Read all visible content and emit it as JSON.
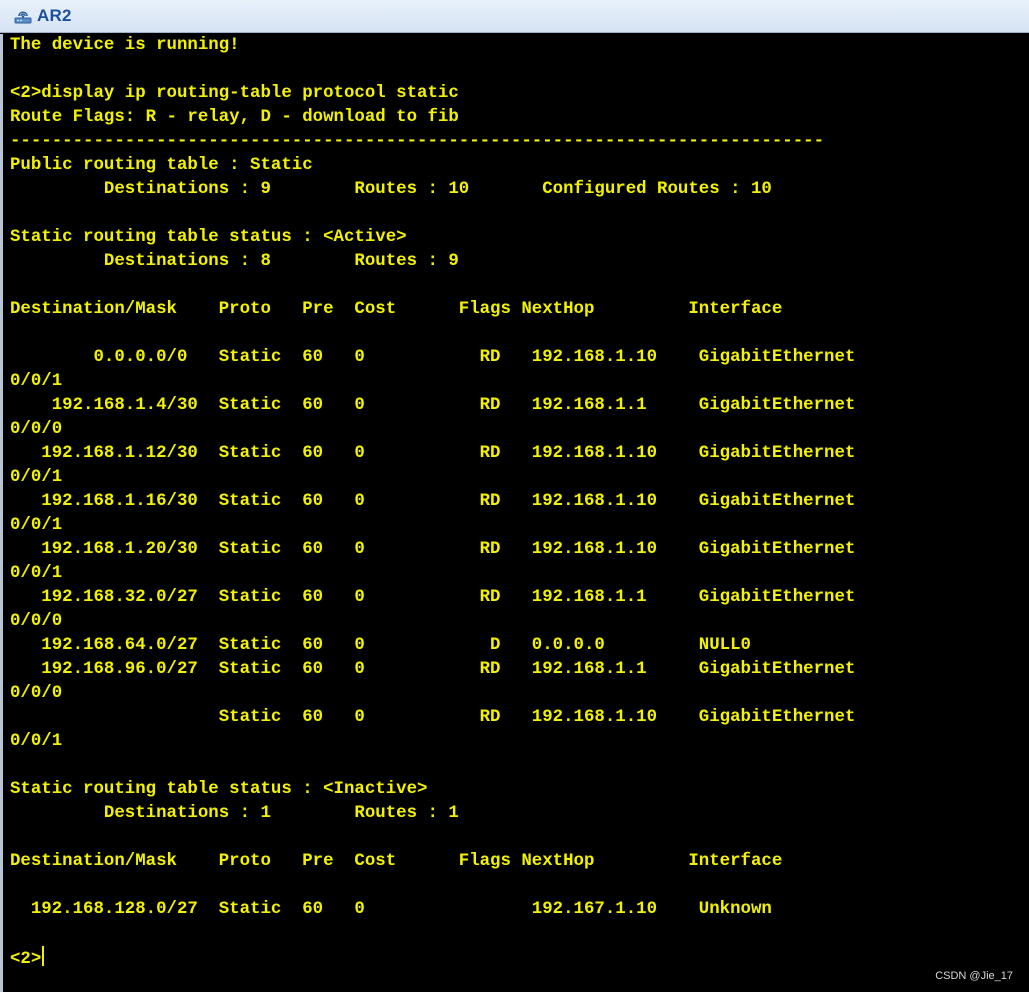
{
  "window": {
    "title": "AR2",
    "icon": "router-icon"
  },
  "terminal": {
    "lines": [
      "The device is running!",
      "",
      "<2>display ip routing-table protocol static",
      "Route Flags: R - relay, D - download to fib",
      "------------------------------------------------------------------------------",
      "Public routing table : Static",
      "         Destinations : 9        Routes : 10       Configured Routes : 10",
      "",
      "Static routing table status : <Active>",
      "         Destinations : 8        Routes : 9",
      "",
      "Destination/Mask    Proto   Pre  Cost      Flags NextHop         Interface",
      "",
      "        0.0.0.0/0   Static  60   0           RD   192.168.1.10    GigabitEthernet",
      "0/0/1",
      "    192.168.1.4/30  Static  60   0           RD   192.168.1.1     GigabitEthernet",
      "0/0/0",
      "   192.168.1.12/30  Static  60   0           RD   192.168.1.10    GigabitEthernet",
      "0/0/1",
      "   192.168.1.16/30  Static  60   0           RD   192.168.1.10    GigabitEthernet",
      "0/0/1",
      "   192.168.1.20/30  Static  60   0           RD   192.168.1.10    GigabitEthernet",
      "0/0/1",
      "   192.168.32.0/27  Static  60   0           RD   192.168.1.1     GigabitEthernet",
      "0/0/0",
      "   192.168.64.0/27  Static  60   0            D   0.0.0.0         NULL0",
      "   192.168.96.0/27  Static  60   0           RD   192.168.1.1     GigabitEthernet",
      "0/0/0",
      "                    Static  60   0           RD   192.168.1.10    GigabitEthernet",
      "0/0/1",
      "",
      "Static routing table status : <Inactive>",
      "         Destinations : 1        Routes : 1",
      "",
      "Destination/Mask    Proto   Pre  Cost      Flags NextHop         Interface",
      "",
      "  192.168.128.0/27  Static  60   0                192.167.1.10    Unknown",
      ""
    ],
    "prompt": "<2>"
  },
  "watermark": "CSDN @Jie_17",
  "colors": {
    "terminal_bg": "#000000",
    "terminal_fg": "#f2f200",
    "title_text": "#1d4e9a"
  }
}
